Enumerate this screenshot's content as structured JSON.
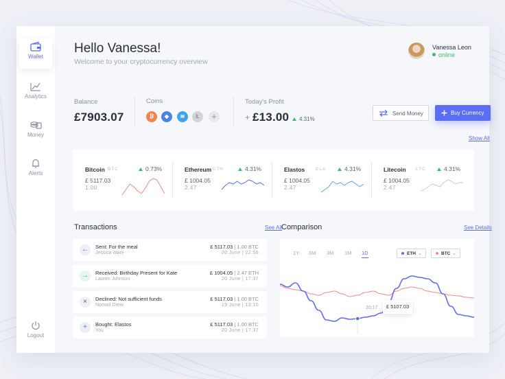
{
  "sidebar": {
    "items": [
      {
        "label": "Wallet",
        "icon": "wallet-icon",
        "active": true
      },
      {
        "label": "Analytics",
        "icon": "analytics-icon",
        "active": false
      },
      {
        "label": "Money",
        "icon": "money-icon",
        "active": false
      },
      {
        "label": "Alerts",
        "icon": "bell-icon",
        "active": false
      }
    ],
    "logout_label": "Logout"
  },
  "header": {
    "title": "Hello Vanessa!",
    "subtitle": "Welcome to your cryptocurrency overview"
  },
  "user": {
    "name": "Vanessa Leon",
    "status": "online"
  },
  "summary": {
    "balance_label": "Balance",
    "balance_value": "£7903.07",
    "coins_label": "Coins",
    "coins": [
      {
        "name": "Bitcoin",
        "icon": "bitcoin-icon",
        "color": "#f0834e",
        "glyph": "₿"
      },
      {
        "name": "Ethereum",
        "icon": "ethereum-icon",
        "color": "#4d82e8",
        "glyph": "◆"
      },
      {
        "name": "Elastos",
        "icon": "elastos-icon",
        "color": "#3fa3ee",
        "glyph": "≋"
      },
      {
        "name": "Litecoin",
        "icon": "litecoin-icon",
        "color": "#d3d4da",
        "glyph": "Ł"
      },
      {
        "name": "Add coin",
        "icon": "plus-icon",
        "color": "#e7e8ee",
        "glyph": "+"
      }
    ],
    "profit_label": "Today's Profit",
    "profit_sign": "+",
    "profit_value": "£13.00",
    "profit_pct": "4.31%"
  },
  "actions": {
    "send_label": "Send Money",
    "buy_label": "Buy Currency"
  },
  "show_all_label": "Show All",
  "coin_cards": [
    {
      "name": "Bitcoin",
      "symbol": "BTC",
      "pct": "0.73%",
      "value": "£ 5117.03",
      "sub": "1.00",
      "color": "#f08a80"
    },
    {
      "name": "Ethereum",
      "symbol": "ETH",
      "pct": "4.31%",
      "value": "£ 1004.05",
      "sub": "2.47",
      "color": "#5b6df2"
    },
    {
      "name": "Elastos",
      "symbol": "ELA",
      "pct": "4.31%",
      "value": "£ 1004.05",
      "sub": "2.47",
      "color": "#52a4ef"
    },
    {
      "name": "Litecoin",
      "symbol": "LTC",
      "pct": "4.31%",
      "value": "£ 1004.05",
      "sub": "2.47",
      "color": "#c9cbd4"
    }
  ],
  "transactions": {
    "title": "Transactions",
    "see_all_label": "See All",
    "items": [
      {
        "title": "Sent: For the meal",
        "who": "Jessica Ware",
        "amount": "£ 5117.03",
        "unit": "| 1.00 BTC",
        "date": "20 June | 22:56",
        "icon": "arrow-left-icon",
        "glyph": "←",
        "color": "#5b6df2",
        "bg": "#eceefd"
      },
      {
        "title": "Received: Birthday Present for Kate",
        "who": "Lauren Johnson",
        "amount": "£ 1004.05",
        "unit": "| 2.47 ETH",
        "date": "20 June | 17:37",
        "icon": "arrow-right-icon",
        "glyph": "→",
        "color": "#3dbb6c",
        "bg": "#e5f6ec"
      },
      {
        "title": "Declined: Not sufficient funds",
        "who": "Nomad Drew",
        "amount": "£ 5117.03",
        "unit": "| 1.00 BTC",
        "date": "19 June | 13:10",
        "icon": "close-icon",
        "glyph": "×",
        "color": "#5a5f70",
        "bg": "#f0f1f5"
      },
      {
        "title": "Bought: Elastos",
        "who": "You",
        "amount": "£ 5117.03",
        "unit": "| 1.00 BTC",
        "date": "20 June | 17:37",
        "icon": "plus-icon",
        "glyph": "+",
        "color": "#5b6df2",
        "bg": "#eceefd"
      }
    ]
  },
  "comparison": {
    "title": "Comparison",
    "see_details_label": "See Details",
    "ranges": [
      "1Y",
      "6M",
      "3M",
      "1M",
      "1D"
    ],
    "active_range": "1D",
    "selects": [
      {
        "label": "ETH",
        "color": "#5b6df2"
      },
      {
        "label": "BTC",
        "color": "#f08a80"
      }
    ],
    "tooltip_time": "20:17",
    "tooltip_value": "£ 5107.03"
  },
  "chart_data": {
    "type": "line",
    "series": [
      {
        "name": "ETH",
        "color": "#5b6df2",
        "values": [
          72,
          68,
          74,
          62,
          48,
          34,
          20,
          18,
          23,
          21,
          22,
          24,
          26,
          30,
          46,
          66,
          80,
          84,
          82,
          80,
          74,
          58,
          40,
          28,
          26,
          24
        ]
      },
      {
        "name": "BTC",
        "color": "#f08a80",
        "values": [
          70,
          66,
          64,
          62,
          58,
          56,
          60,
          62,
          58,
          54,
          56,
          60,
          62,
          58,
          56,
          62,
          66,
          68,
          66,
          62,
          60,
          58,
          56,
          55,
          53,
          52
        ]
      }
    ]
  }
}
